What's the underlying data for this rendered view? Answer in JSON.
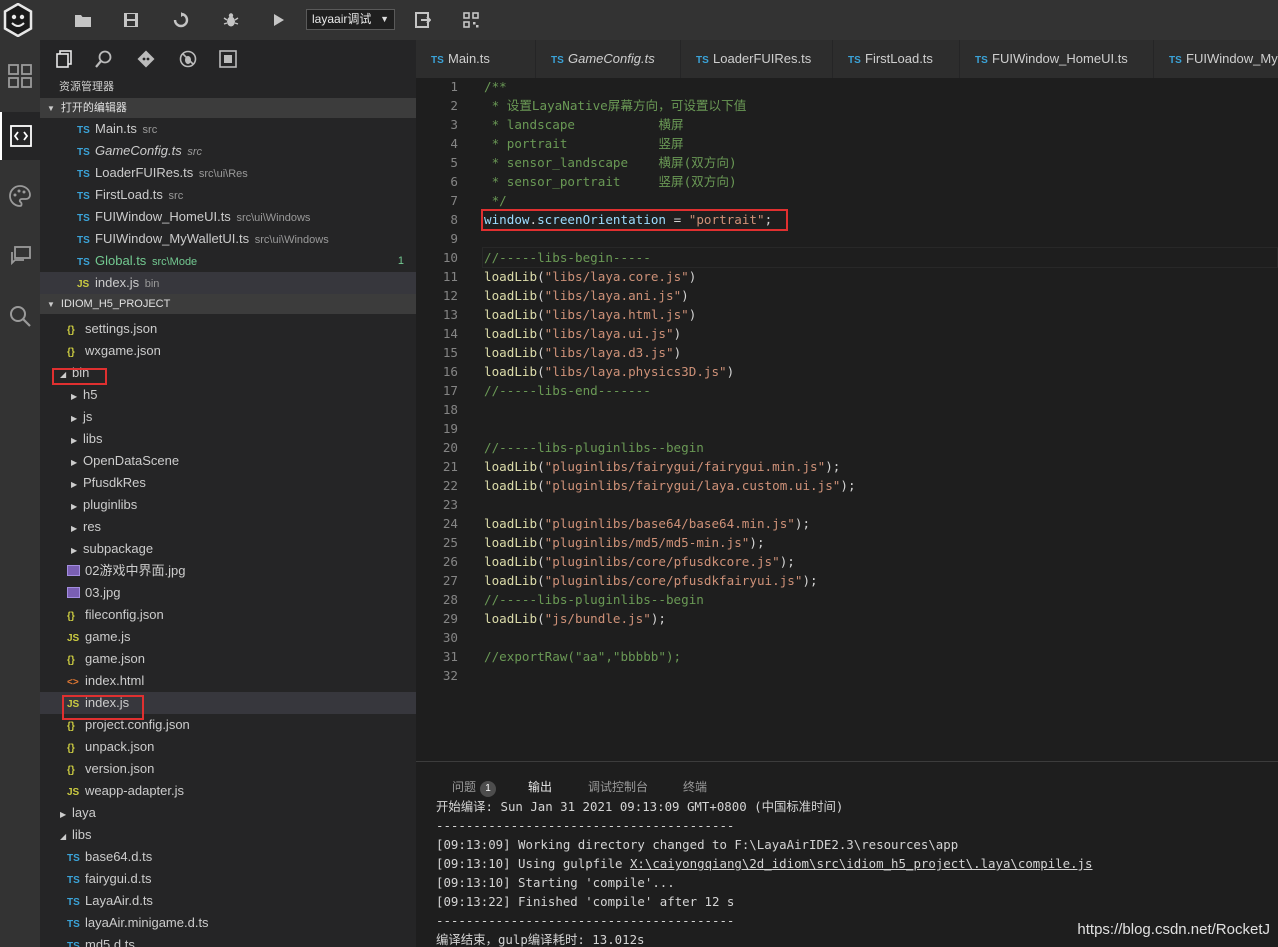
{
  "toolbar": {
    "run_config": "layaair调试"
  },
  "sidebar": {
    "title": "资源管理器",
    "open_editors_header": "打开的编辑器",
    "open_editors": [
      {
        "badge": "TS",
        "name": "Main.ts",
        "path": "src"
      },
      {
        "badge": "TS",
        "name": "GameConfig.ts",
        "path": "src"
      },
      {
        "badge": "TS",
        "name": "LoaderFUIRes.ts",
        "path": "src\\ui\\Res"
      },
      {
        "badge": "TS",
        "name": "FirstLoad.ts",
        "path": "src"
      },
      {
        "badge": "TS",
        "name": "FUIWindow_HomeUI.ts",
        "path": "src\\ui\\Windows"
      },
      {
        "badge": "TS",
        "name": "FUIWindow_MyWalletUI.ts",
        "path": "src\\ui\\Windows"
      },
      {
        "badge": "TS",
        "name": "Global.ts",
        "path": "src\\Mode",
        "count": "1"
      },
      {
        "badge": "JS",
        "name": "index.js",
        "path": "bin"
      }
    ],
    "project_header": "IDIOM_H5_PROJECT",
    "tree": [
      {
        "icon": "{}",
        "name": "settings.json"
      },
      {
        "icon": "{}",
        "name": "wxgame.json"
      },
      {
        "icon": "▲",
        "name": "bin"
      },
      {
        "icon": "▶",
        "name": "h5"
      },
      {
        "icon": "▶",
        "name": "js"
      },
      {
        "icon": "▶",
        "name": "libs"
      },
      {
        "icon": "▶",
        "name": "OpenDataScene"
      },
      {
        "icon": "▶",
        "name": "PfusdkRes"
      },
      {
        "icon": "▶",
        "name": "pluginlibs"
      },
      {
        "icon": "▶",
        "name": "res"
      },
      {
        "icon": "▶",
        "name": "subpackage"
      },
      {
        "icon": "img",
        "name": "02游戏中界面.jpg"
      },
      {
        "icon": "img",
        "name": "03.jpg"
      },
      {
        "icon": "{}",
        "name": "fileconfig.json"
      },
      {
        "icon": "JS",
        "name": "game.js"
      },
      {
        "icon": "{}",
        "name": "game.json"
      },
      {
        "icon": "<>",
        "name": "index.html"
      },
      {
        "icon": "JS",
        "name": "index.js"
      },
      {
        "icon": "{}",
        "name": "project.config.json"
      },
      {
        "icon": "{}",
        "name": "unpack.json"
      },
      {
        "icon": "{}",
        "name": "version.json"
      },
      {
        "icon": "JS",
        "name": "weapp-adapter.js"
      },
      {
        "icon": "▶",
        "name": "laya"
      },
      {
        "icon": "▲",
        "name": "libs"
      },
      {
        "icon": "TS",
        "name": "base64.d.ts"
      },
      {
        "icon": "TS",
        "name": "fairygui.d.ts"
      },
      {
        "icon": "TS",
        "name": "LayaAir.d.ts"
      },
      {
        "icon": "TS",
        "name": "layaAir.minigame.d.ts"
      },
      {
        "icon": "TS",
        "name": "md5.d.ts"
      }
    ]
  },
  "tabs": [
    {
      "badge": "TS",
      "label": "Main.ts"
    },
    {
      "badge": "TS",
      "label": "GameConfig.ts"
    },
    {
      "badge": "TS",
      "label": "LoaderFUIRes.ts"
    },
    {
      "badge": "TS",
      "label": "FirstLoad.ts"
    },
    {
      "badge": "TS",
      "label": "FUIWindow_HomeUI.ts"
    },
    {
      "badge": "TS",
      "label": "FUIWindow_MyWalletUI.ts"
    }
  ],
  "editor": {
    "lines": [
      {
        "n": "1",
        "parts": [
          [
            "c-com",
            "/**"
          ]
        ]
      },
      {
        "n": "2",
        "parts": [
          [
            "c-com",
            " * 设置LayaNative屏幕方向，可设置以下值"
          ]
        ]
      },
      {
        "n": "3",
        "parts": [
          [
            "c-com",
            " * landscape           横屏"
          ]
        ]
      },
      {
        "n": "4",
        "parts": [
          [
            "c-com",
            " * portrait            竖屏"
          ]
        ]
      },
      {
        "n": "5",
        "parts": [
          [
            "c-com",
            " * sensor_landscape    横屏(双方向)"
          ]
        ]
      },
      {
        "n": "6",
        "parts": [
          [
            "c-com",
            " * sensor_portrait     竖屏(双方向)"
          ]
        ]
      },
      {
        "n": "7",
        "parts": [
          [
            "c-com",
            " */"
          ]
        ]
      },
      {
        "n": "8",
        "parts": [
          [
            "c-var",
            "window"
          ],
          [
            "c-pl",
            "."
          ],
          [
            "c-var",
            "screenOrientation"
          ],
          [
            "c-pl",
            " = "
          ],
          [
            "c-str",
            "\"portrait\""
          ],
          [
            "c-pl",
            ";"
          ]
        ]
      },
      {
        "n": "9",
        "parts": []
      },
      {
        "n": "10",
        "parts": [
          [
            "c-com",
            "//-----libs-begin-----"
          ]
        ]
      },
      {
        "n": "11",
        "parts": [
          [
            "c-fn",
            "loadLib"
          ],
          [
            "c-pl",
            "("
          ],
          [
            "c-str",
            "\"libs/laya.core.js\""
          ],
          [
            "c-pl",
            ")"
          ]
        ]
      },
      {
        "n": "12",
        "parts": [
          [
            "c-fn",
            "loadLib"
          ],
          [
            "c-pl",
            "("
          ],
          [
            "c-str",
            "\"libs/laya.ani.js\""
          ],
          [
            "c-pl",
            ")"
          ]
        ]
      },
      {
        "n": "13",
        "parts": [
          [
            "c-fn",
            "loadLib"
          ],
          [
            "c-pl",
            "("
          ],
          [
            "c-str",
            "\"libs/laya.html.js\""
          ],
          [
            "c-pl",
            ")"
          ]
        ]
      },
      {
        "n": "14",
        "parts": [
          [
            "c-fn",
            "loadLib"
          ],
          [
            "c-pl",
            "("
          ],
          [
            "c-str",
            "\"libs/laya.ui.js\""
          ],
          [
            "c-pl",
            ")"
          ]
        ]
      },
      {
        "n": "15",
        "parts": [
          [
            "c-fn",
            "loadLib"
          ],
          [
            "c-pl",
            "("
          ],
          [
            "c-str",
            "\"libs/laya.d3.js\""
          ],
          [
            "c-pl",
            ")"
          ]
        ]
      },
      {
        "n": "16",
        "parts": [
          [
            "c-fn",
            "loadLib"
          ],
          [
            "c-pl",
            "("
          ],
          [
            "c-str",
            "\"libs/laya.physics3D.js\""
          ],
          [
            "c-pl",
            ")"
          ]
        ]
      },
      {
        "n": "17",
        "parts": [
          [
            "c-com",
            "//-----libs-end-------"
          ]
        ]
      },
      {
        "n": "18",
        "parts": []
      },
      {
        "n": "19",
        "parts": []
      },
      {
        "n": "20",
        "parts": [
          [
            "c-com",
            "//-----libs-pluginlibs--begin"
          ]
        ]
      },
      {
        "n": "21",
        "parts": [
          [
            "c-fn",
            "loadLib"
          ],
          [
            "c-pl",
            "("
          ],
          [
            "c-str",
            "\"pluginlibs/fairygui/fairygui.min.js\""
          ],
          [
            "c-pl",
            ");"
          ]
        ]
      },
      {
        "n": "22",
        "parts": [
          [
            "c-fn",
            "loadLib"
          ],
          [
            "c-pl",
            "("
          ],
          [
            "c-str",
            "\"pluginlibs/fairygui/laya.custom.ui.js\""
          ],
          [
            "c-pl",
            ");"
          ]
        ]
      },
      {
        "n": "23",
        "parts": []
      },
      {
        "n": "24",
        "parts": [
          [
            "c-fn",
            "loadLib"
          ],
          [
            "c-pl",
            "("
          ],
          [
            "c-str",
            "\"pluginlibs/base64/base64.min.js\""
          ],
          [
            "c-pl",
            ");"
          ]
        ]
      },
      {
        "n": "25",
        "parts": [
          [
            "c-fn",
            "loadLib"
          ],
          [
            "c-pl",
            "("
          ],
          [
            "c-str",
            "\"pluginlibs/md5/md5-min.js\""
          ],
          [
            "c-pl",
            ");"
          ]
        ]
      },
      {
        "n": "26",
        "parts": [
          [
            "c-fn",
            "loadLib"
          ],
          [
            "c-pl",
            "("
          ],
          [
            "c-str",
            "\"pluginlibs/core/pfusdkcore.js\""
          ],
          [
            "c-pl",
            ");"
          ]
        ]
      },
      {
        "n": "27",
        "parts": [
          [
            "c-fn",
            "loadLib"
          ],
          [
            "c-pl",
            "("
          ],
          [
            "c-str",
            "\"pluginlibs/core/pfusdkfairyui.js\""
          ],
          [
            "c-pl",
            ");"
          ]
        ]
      },
      {
        "n": "28",
        "parts": [
          [
            "c-com",
            "//-----libs-pluginlibs--begin"
          ]
        ]
      },
      {
        "n": "29",
        "parts": [
          [
            "c-fn",
            "loadLib"
          ],
          [
            "c-pl",
            "("
          ],
          [
            "c-str",
            "\"js/bundle.js\""
          ],
          [
            "c-pl",
            ");"
          ]
        ]
      },
      {
        "n": "30",
        "parts": []
      },
      {
        "n": "31",
        "parts": [
          [
            "c-com",
            "//exportRaw(\"aa\",\"bbbbb\");"
          ]
        ]
      },
      {
        "n": "32",
        "parts": []
      }
    ]
  },
  "panel": {
    "tabs": [
      {
        "label": "问题",
        "badge": "1"
      },
      {
        "label": "输出"
      },
      {
        "label": "调试控制台"
      },
      {
        "label": "终端"
      }
    ],
    "output": [
      {
        "text": "开始编译: Sun Jan 31 2021 09:13:09 GMT+0800 (中国标准时间)"
      },
      {
        "text": "----------------------------------------"
      },
      {
        "text": "[09:13:09] Working directory changed to F:\\LayaAirIDE2.3\\resources\\app"
      },
      {
        "pre": "[09:13:10] Using gulpfile ",
        "link": "X:\\caiyongqiang\\2d_idiom\\src\\idiom_h5_project\\.laya\\compile.js"
      },
      {
        "text": "[09:13:10] Starting 'compile'..."
      },
      {
        "text": "[09:13:22] Finished 'compile' after 12 s"
      },
      {
        "text": "----------------------------------------"
      },
      {
        "text": "编译结束，gulp编译耗时: 13.012s"
      }
    ]
  },
  "watermark": "https://blog.csdn.net/RocketJ"
}
